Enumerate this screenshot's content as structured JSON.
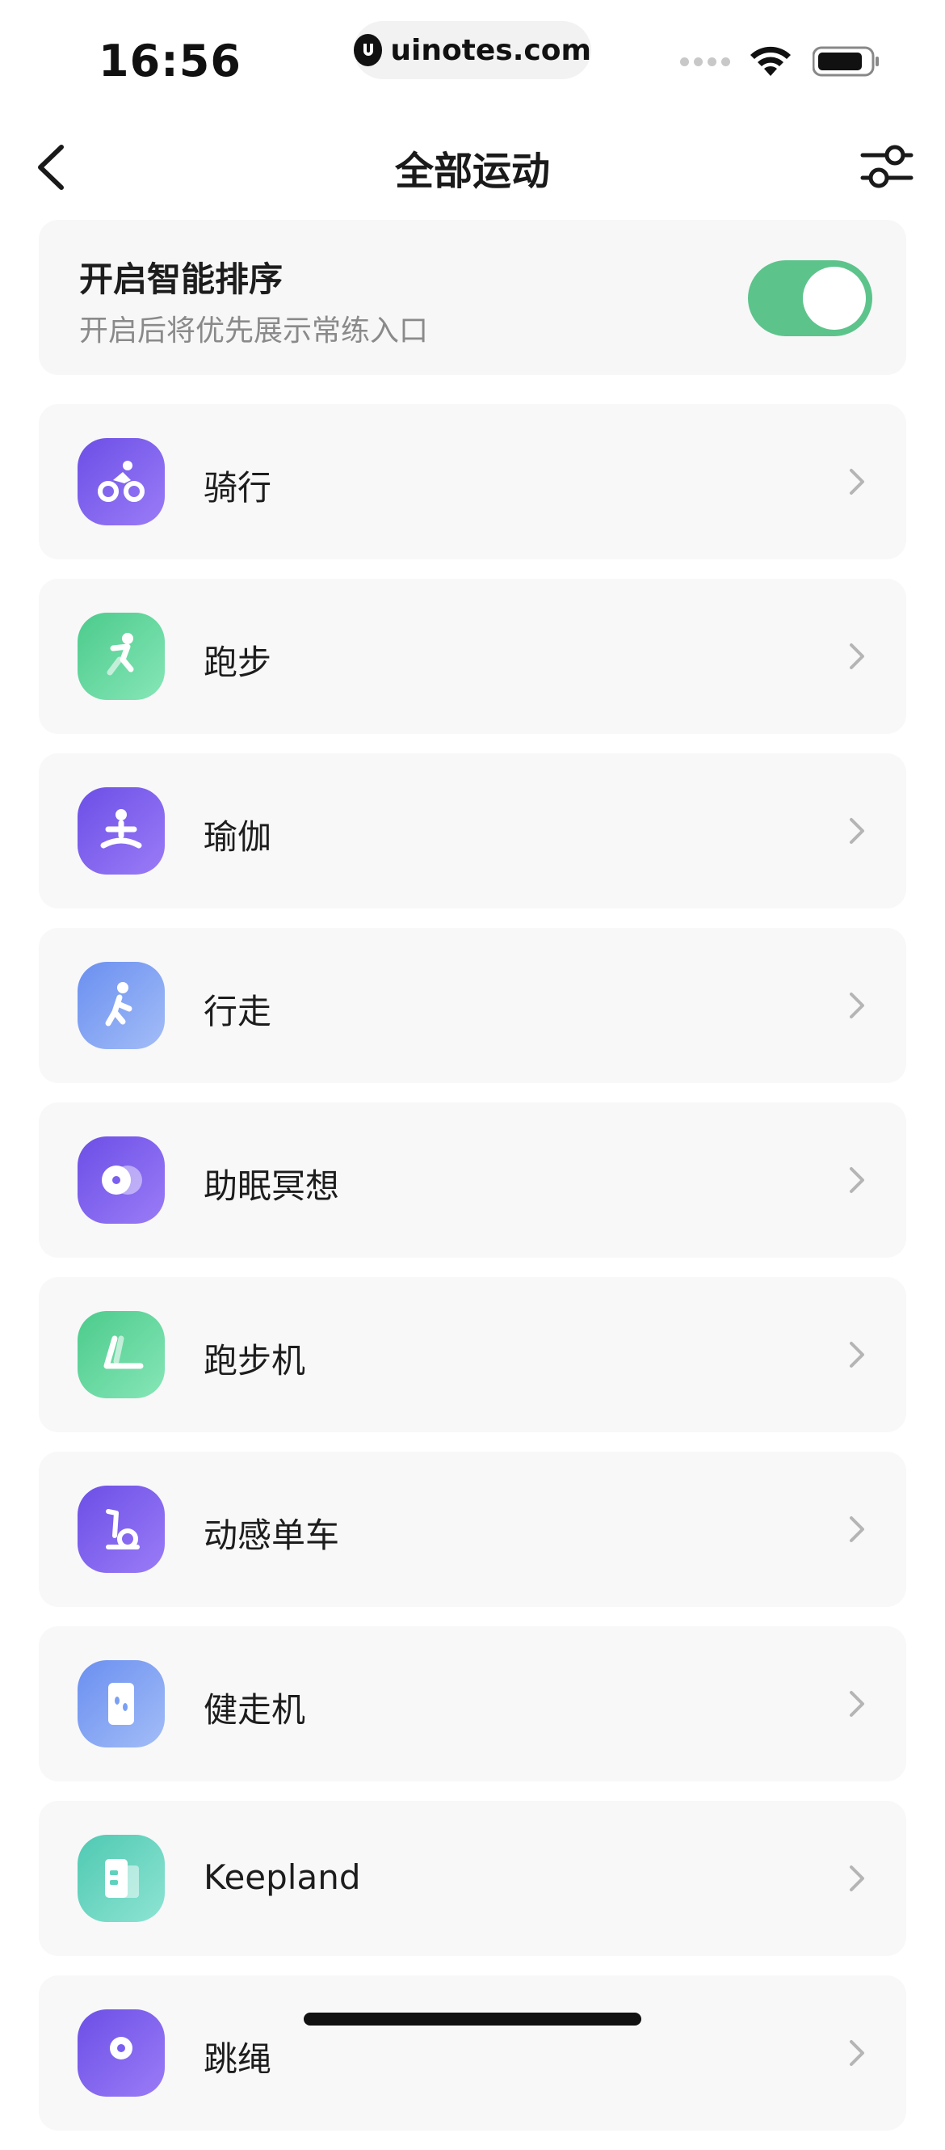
{
  "status_bar": {
    "time": "16:56",
    "url": "uinotes.com"
  },
  "nav": {
    "title": "全部运动"
  },
  "smart_sort": {
    "title": "开启智能排序",
    "subtitle": "开启后将优先展示常练入口",
    "enabled": true
  },
  "colors": {
    "toggle_on": "#5cc48b",
    "purple": "#7a5ff0",
    "green": "#5fd39c",
    "blue": "#7aa0f5",
    "teal": "#5fd2bd"
  },
  "sports": [
    {
      "name": "骑行",
      "icon": "cycling-icon",
      "color": "purple"
    },
    {
      "name": "跑步",
      "icon": "running-icon",
      "color": "green"
    },
    {
      "name": "瑜伽",
      "icon": "yoga-icon",
      "color": "purple"
    },
    {
      "name": "行走",
      "icon": "walking-icon",
      "color": "blue"
    },
    {
      "name": "助眠冥想",
      "icon": "meditation-icon",
      "color": "purple"
    },
    {
      "name": "跑步机",
      "icon": "treadmill-icon",
      "color": "green"
    },
    {
      "name": "动感单车",
      "icon": "spin-bike-icon",
      "color": "purple"
    },
    {
      "name": "健走机",
      "icon": "walking-pad-icon",
      "color": "blue"
    },
    {
      "name": "Keepland",
      "icon": "keepland-icon",
      "color": "teal"
    },
    {
      "name": "跳绳",
      "icon": "jump-rope-icon",
      "color": "purple"
    }
  ]
}
